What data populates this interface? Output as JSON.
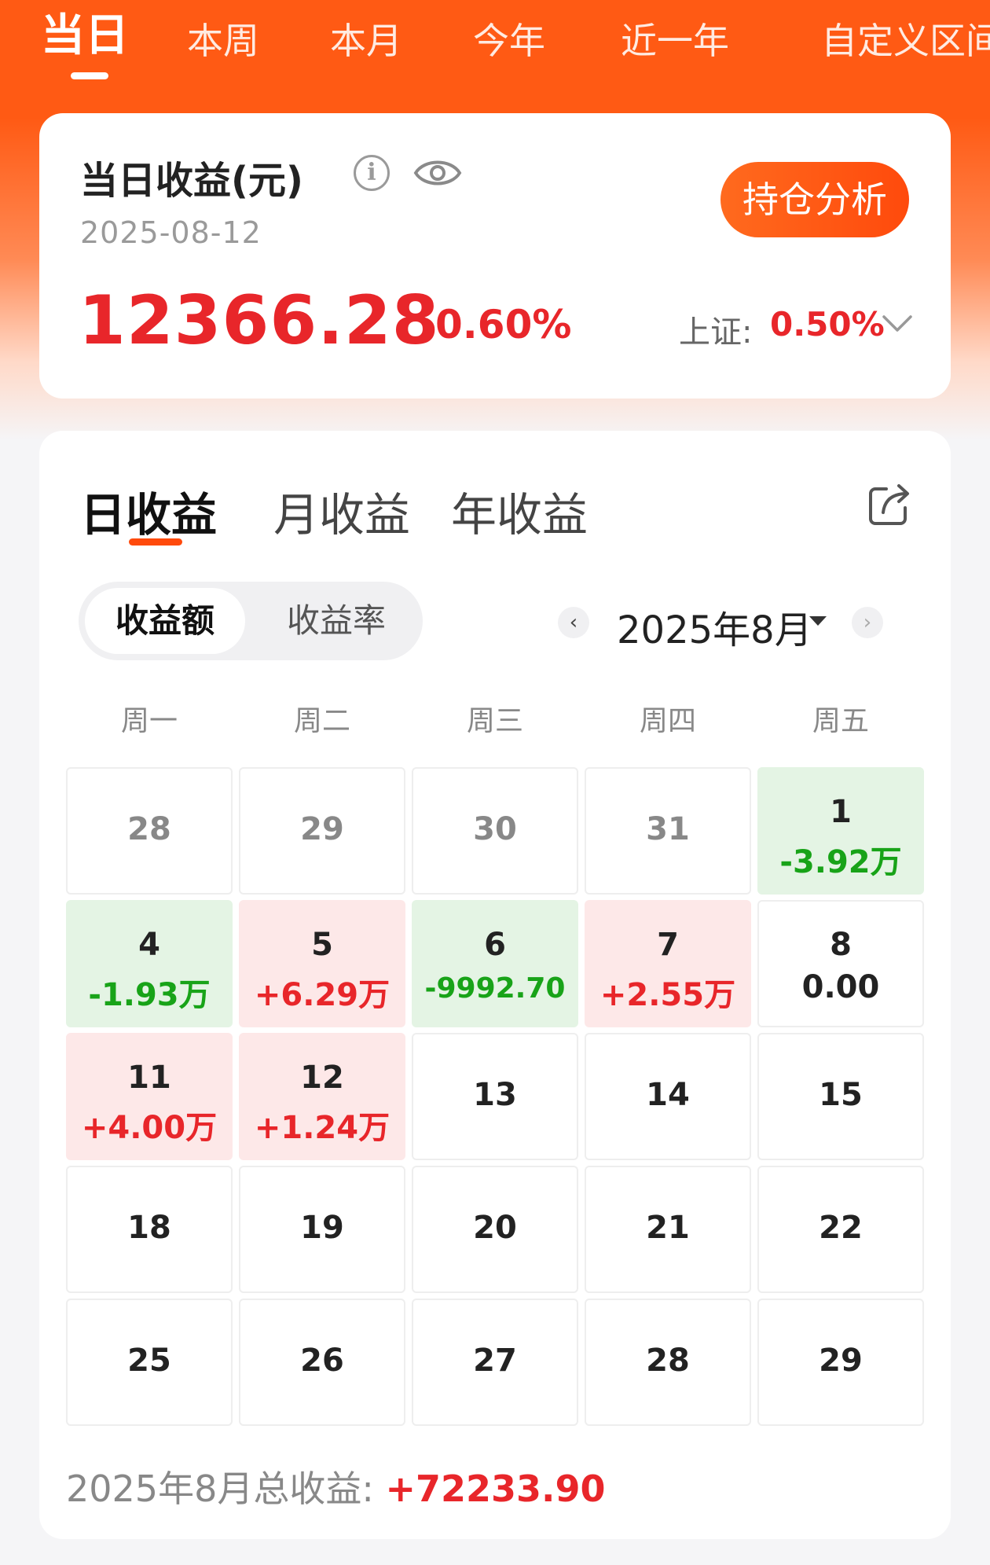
{
  "period_tabs": [
    {
      "label": "当日",
      "active": true
    },
    {
      "label": "本周"
    },
    {
      "label": "本月"
    },
    {
      "label": "今年"
    },
    {
      "label": "近一年"
    },
    {
      "label": "自定义区间"
    }
  ],
  "summary": {
    "title": "当日收益(元)",
    "info_icon": "info-icon",
    "visibility_icon": "eye-icon",
    "date": "2025-08-12",
    "amount": "12366.28",
    "percent": "0.60%",
    "analysis_button": "持仓分析",
    "index_label": "上证:",
    "index_value": "0.50%"
  },
  "calendar": {
    "type_tabs": [
      {
        "label": "日收益",
        "active": true
      },
      {
        "label": "月收益"
      },
      {
        "label": "年收益"
      }
    ],
    "share_icon": "share-icon",
    "segment": {
      "active": "收益额",
      "inactive": "收益率"
    },
    "prev_glyph": "‹",
    "next_glyph": "›",
    "month_label": "2025年8月",
    "weekdays": [
      "周一",
      "周二",
      "周三",
      "周四",
      "周五"
    ],
    "weeks": [
      [
        {
          "day": "28",
          "value": "",
          "type": "other"
        },
        {
          "day": "29",
          "value": "",
          "type": "other"
        },
        {
          "day": "30",
          "value": "",
          "type": "other"
        },
        {
          "day": "31",
          "value": "",
          "type": "other"
        },
        {
          "day": "1",
          "value": "-3.92万",
          "type": "neg"
        }
      ],
      [
        {
          "day": "4",
          "value": "-1.93万",
          "type": "neg"
        },
        {
          "day": "5",
          "value": "+6.29万",
          "type": "pos"
        },
        {
          "day": "6",
          "value": "-9992.70",
          "type": "neg"
        },
        {
          "day": "7",
          "value": "+2.55万",
          "type": "pos"
        },
        {
          "day": "8",
          "value": "0.00",
          "type": "zero"
        }
      ],
      [
        {
          "day": "11",
          "value": "+4.00万",
          "type": "pos"
        },
        {
          "day": "12",
          "value": "+1.24万",
          "type": "pos"
        },
        {
          "day": "13",
          "value": "",
          "type": "future"
        },
        {
          "day": "14",
          "value": "",
          "type": "future"
        },
        {
          "day": "15",
          "value": "",
          "type": "future"
        }
      ],
      [
        {
          "day": "18",
          "value": "",
          "type": "future"
        },
        {
          "day": "19",
          "value": "",
          "type": "future"
        },
        {
          "day": "20",
          "value": "",
          "type": "future"
        },
        {
          "day": "21",
          "value": "",
          "type": "future"
        },
        {
          "day": "22",
          "value": "",
          "type": "future"
        }
      ],
      [
        {
          "day": "25",
          "value": "",
          "type": "future"
        },
        {
          "day": "26",
          "value": "",
          "type": "future"
        },
        {
          "day": "27",
          "value": "",
          "type": "future"
        },
        {
          "day": "28",
          "value": "",
          "type": "future"
        },
        {
          "day": "29",
          "value": "",
          "type": "future"
        }
      ]
    ],
    "total_label": "2025年8月总收益:",
    "total_value": "+72233.90"
  },
  "colors": {
    "brand_orange": "#ff5a14",
    "profit_red": "#e8262a",
    "loss_green": "#18a318",
    "profit_bg": "#fde8e8",
    "loss_bg": "#e4f4e4"
  }
}
